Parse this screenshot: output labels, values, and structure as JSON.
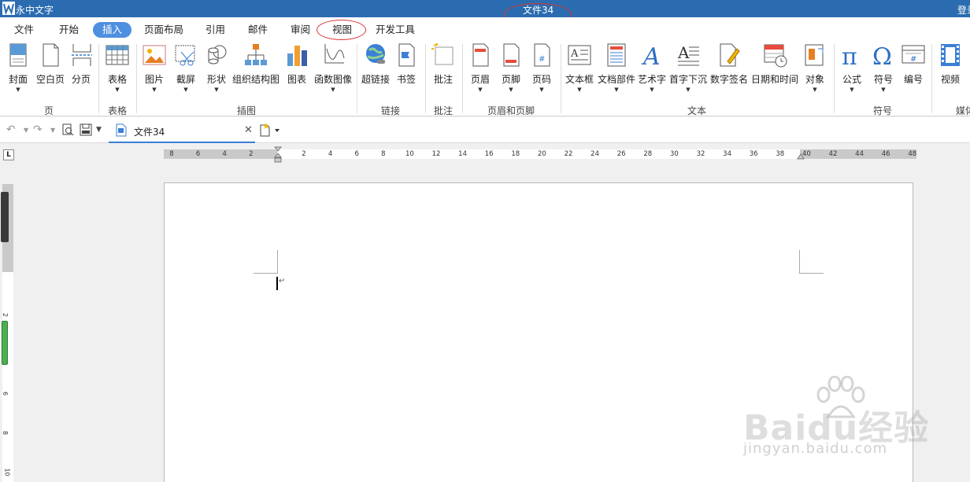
{
  "app": {
    "name": "永中文字",
    "document_title": "文件34",
    "login_label": "登录"
  },
  "menu": {
    "tabs": [
      {
        "label": "文件"
      },
      {
        "label": "开始"
      },
      {
        "label": "插入"
      },
      {
        "label": "页面布局"
      },
      {
        "label": "引用"
      },
      {
        "label": "邮件"
      },
      {
        "label": "审阅"
      },
      {
        "label": "视图"
      },
      {
        "label": "开发工具"
      }
    ],
    "active": "插入"
  },
  "ribbon": {
    "buttons": [
      {
        "label": "封面",
        "icon": "cover-icon"
      },
      {
        "label": "空白页",
        "icon": "blank-page-icon"
      },
      {
        "label": "分页",
        "icon": "page-break-icon"
      },
      {
        "label": "表格",
        "icon": "table-icon"
      },
      {
        "label": "图片",
        "icon": "picture-icon"
      },
      {
        "label": "截屏",
        "icon": "screenshot-icon"
      },
      {
        "label": "形状",
        "icon": "shapes-icon"
      },
      {
        "label": "组织结构图",
        "icon": "org-chart-icon"
      },
      {
        "label": "图表",
        "icon": "chart-icon"
      },
      {
        "label": "函数图像",
        "icon": "function-graph-icon"
      },
      {
        "label": "超链接",
        "icon": "hyperlink-icon"
      },
      {
        "label": "书签",
        "icon": "bookmark-icon"
      },
      {
        "label": "批注",
        "icon": "comment-icon"
      },
      {
        "label": "页眉",
        "icon": "header-icon"
      },
      {
        "label": "页脚",
        "icon": "footer-icon"
      },
      {
        "label": "页码",
        "icon": "page-number-icon"
      },
      {
        "label": "文本框",
        "icon": "textbox-icon"
      },
      {
        "label": "文档部件",
        "icon": "doc-parts-icon"
      },
      {
        "label": "艺术字",
        "icon": "wordart-icon"
      },
      {
        "label": "首字下沉",
        "icon": "drop-cap-icon"
      },
      {
        "label": "数字签名",
        "icon": "digital-signature-icon"
      },
      {
        "label": "日期和时间",
        "icon": "date-time-icon"
      },
      {
        "label": "对象",
        "icon": "object-icon"
      },
      {
        "label": "公式",
        "icon": "formula-icon"
      },
      {
        "label": "符号",
        "icon": "symbol-icon"
      },
      {
        "label": "编号",
        "icon": "numbering-icon"
      },
      {
        "label": "视频",
        "icon": "video-icon"
      }
    ],
    "groups": [
      {
        "label": "页"
      },
      {
        "label": "表格"
      },
      {
        "label": "插图"
      },
      {
        "label": "链接"
      },
      {
        "label": "批注"
      },
      {
        "label": "页眉和页脚"
      },
      {
        "label": "文本"
      },
      {
        "label": "符号"
      },
      {
        "label": "媒体"
      }
    ]
  },
  "quickbar": {
    "doc_tab_name": "文件34",
    "close_glyph": "✕",
    "undo_glyph": "↶",
    "redo_glyph": "↷"
  },
  "ruler": {
    "corner_label": "L",
    "h_ticks": [
      "8",
      "6",
      "4",
      "2",
      "2",
      "4",
      "6",
      "8",
      "10",
      "12",
      "14",
      "16",
      "18",
      "20",
      "22",
      "24",
      "26",
      "28",
      "30",
      "32",
      "34",
      "36",
      "38",
      "40",
      "42",
      "44",
      "46",
      "48"
    ],
    "v_ticks": [
      "4",
      "2",
      "2",
      "4",
      "6",
      "8",
      "10"
    ]
  },
  "document": {
    "paragraph_mark": "↵"
  },
  "watermark": {
    "brand": "Baidu经验",
    "url": "jingyan.baidu.com"
  },
  "colors": {
    "titlebar": "#2b6cb0",
    "active_tab": "#4f8fe0",
    "annotation_circle": "#dd3333"
  }
}
